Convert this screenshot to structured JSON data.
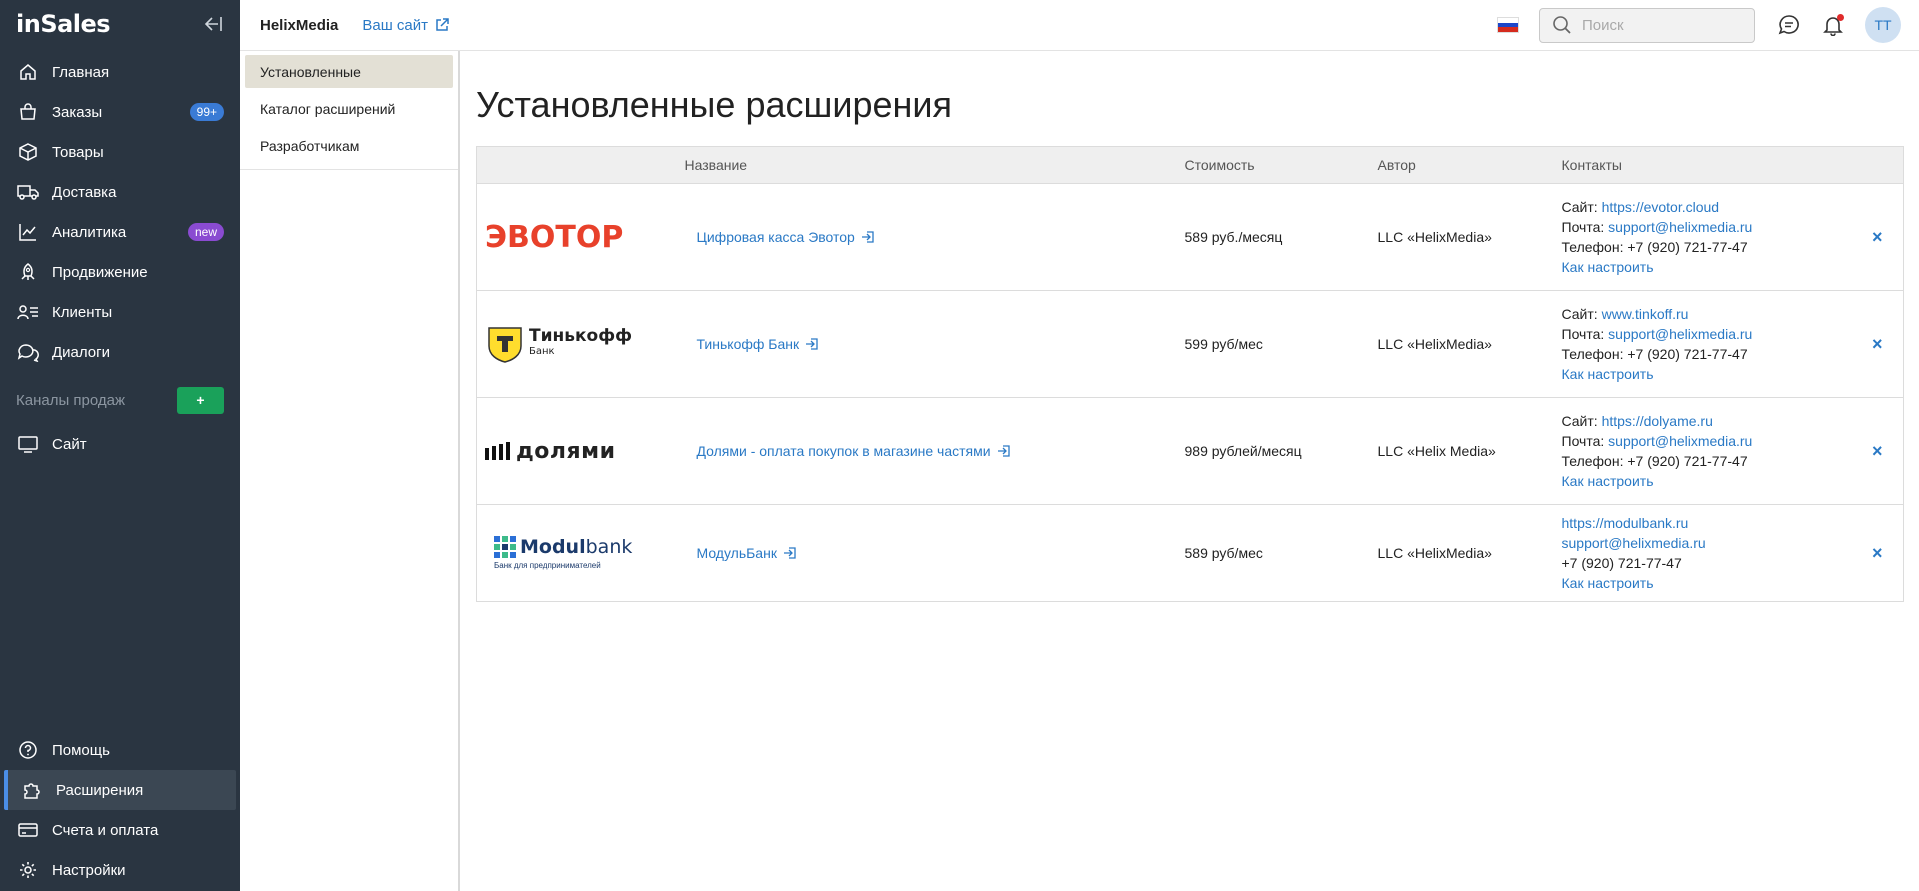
{
  "sidebar": {
    "logo": "inSales",
    "items": [
      {
        "label": "Главная",
        "icon": "home-icon"
      },
      {
        "label": "Заказы",
        "icon": "bag-icon",
        "badge": "99+"
      },
      {
        "label": "Товары",
        "icon": "box-icon"
      },
      {
        "label": "Доставка",
        "icon": "truck-icon"
      },
      {
        "label": "Аналитика",
        "icon": "chart-icon",
        "badge": "new"
      },
      {
        "label": "Продвижение",
        "icon": "rocket-icon"
      },
      {
        "label": "Клиенты",
        "icon": "users-icon"
      },
      {
        "label": "Диалоги",
        "icon": "chat-icon"
      }
    ],
    "channels_label": "Каналы продаж",
    "channels_add": "+",
    "site_item": "Сайт",
    "bottom_items": [
      {
        "label": "Помощь",
        "icon": "help-icon"
      },
      {
        "label": "Расширения",
        "icon": "puzzle-icon",
        "active": true
      },
      {
        "label": "Счета и оплата",
        "icon": "card-icon"
      },
      {
        "label": "Настройки",
        "icon": "gear-icon"
      }
    ]
  },
  "topbar": {
    "shop_name": "HelixMedia",
    "site_link": "Ваш сайт",
    "search_placeholder": "Поиск",
    "avatar": "TT"
  },
  "subnav": {
    "items": [
      "Установленные",
      "Каталог расширений",
      "Разработчикам"
    ],
    "active": 0
  },
  "main": {
    "title": "Установленные расширения",
    "columns": [
      "Название",
      "Стоимость",
      "Автор",
      "Контакты"
    ],
    "rows": [
      {
        "logo": "ЭВОТОР",
        "name": "Цифровая касса Эвотор",
        "cost": "589 руб./месяц",
        "author": "LLC «HelixMedia»",
        "site_label": "Сайт:",
        "site": "https://evotor.cloud",
        "mail_label": "Почта:",
        "mail": "support@helixmedia.ru",
        "phone_label": "Телефон:",
        "phone": "+7 (920) 721-77-47",
        "setup": "Как настроить"
      },
      {
        "logo": "Тинькофф",
        "logo_sub": "Банк",
        "name": "Тинькофф Банк",
        "cost": "599 руб/мес",
        "author": "LLC «HelixMedia»",
        "site_label": "Сайт:",
        "site": "www.tinkoff.ru",
        "mail_label": "Почта:",
        "mail": "support@helixmedia.ru",
        "phone_label": "Телефон:",
        "phone": "+7 (920) 721-77-47",
        "setup": "Как настроить"
      },
      {
        "logo": "долями",
        "name": "Долями - оплата покупок в магазине частями",
        "cost": "989 рублей/месяц",
        "author": "LLC «Helix Media»",
        "site_label": "Сайт:",
        "site": "https://dolyame.ru",
        "mail_label": "Почта:",
        "mail": "support@helixmedia.ru",
        "phone_label": "Телефон:",
        "phone": "+7 (920) 721-77-47",
        "setup": "Как настроить"
      },
      {
        "logo_bold": "Modul",
        "logo_rest": "bank",
        "logo_sub": "Банк для предпринимателей",
        "name": "МодульБанк",
        "cost": "589 руб/мес",
        "author": "LLC «HelixMedia»",
        "site": "https://modulbank.ru",
        "mail": "support@helixmedia.ru",
        "phone": "+7 (920) 721-77-47",
        "setup": "Как настроить"
      }
    ],
    "remove_glyph": "×"
  },
  "colors": {
    "sidebar_bg": "#2a3541",
    "link": "#2a79c5",
    "evotor": "#e8412b",
    "add_button": "#1aa15a",
    "active_indicator": "#4b8ee6"
  }
}
